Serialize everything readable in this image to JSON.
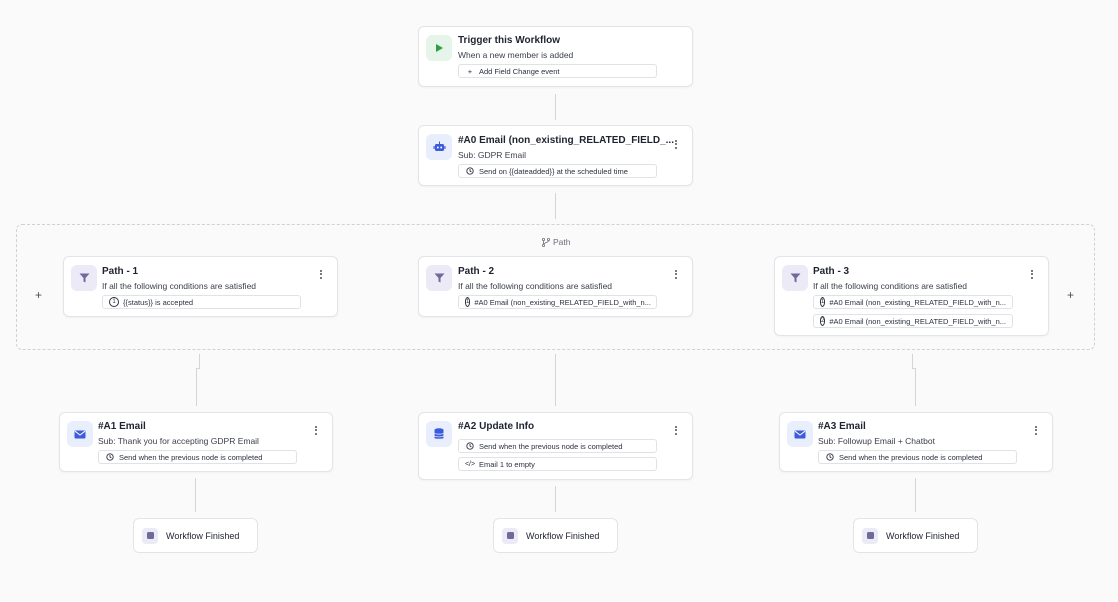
{
  "trigger": {
    "title": "Trigger this Workflow",
    "subtitle": "When a new member is added",
    "chip": "Add Field Change event"
  },
  "a0": {
    "title": "#A0 Email (non_existing_RELATED_FIELD_...",
    "subtitle": "Sub: GDPR Email",
    "chip": "Send on {{dateadded}} at the scheduled time"
  },
  "path_group": {
    "label": "Path"
  },
  "paths": [
    {
      "title": "Path - 1",
      "subtitle": "If all the following conditions are satisfied",
      "conditions": [
        "{{status}} is accepted"
      ]
    },
    {
      "title": "Path - 2",
      "subtitle": "If all the following conditions are satisfied",
      "conditions": [
        "#A0 Email (non_existing_RELATED_FIELD_with_n..."
      ]
    },
    {
      "title": "Path - 3",
      "subtitle": "If all the following conditions are satisfied",
      "conditions": [
        "#A0 Email (non_existing_RELATED_FIELD_with_n...",
        "#A0 Email (non_existing_RELATED_FIELD_with_n..."
      ]
    }
  ],
  "actions": [
    {
      "title": "#A1 Email",
      "subtitle": "Sub: Thank you for accepting GDPR Email",
      "chips": [
        "Send when the previous node is completed"
      ]
    },
    {
      "title": "#A2 Update Info",
      "subtitle": "",
      "chips": [
        "Send when the previous node is completed",
        "Email 1 to empty"
      ]
    },
    {
      "title": "#A3 Email",
      "subtitle": "Sub: Followup Email + Chatbot",
      "chips": [
        "Send when the previous node is completed"
      ]
    }
  ],
  "finished": [
    "Workflow Finished",
    "Workflow Finished",
    "Workflow Finished"
  ],
  "colors": {
    "accent_blue": "#3b5bdb",
    "trigger_green": "#2f9e44",
    "finish_purple": "#6e6a9a"
  }
}
